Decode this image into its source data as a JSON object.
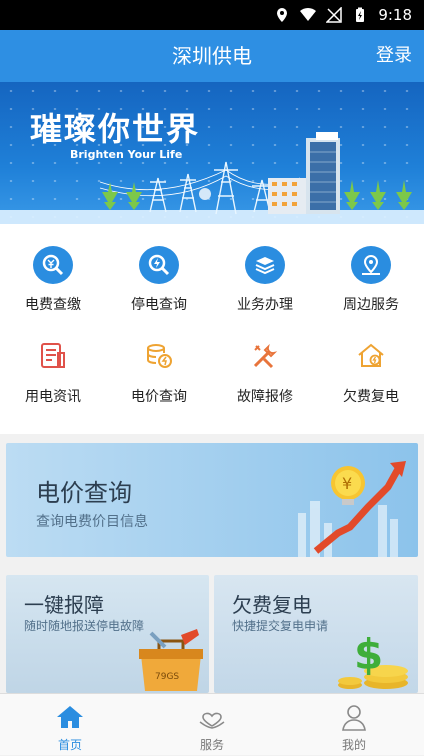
{
  "status": {
    "time": "9:18"
  },
  "header": {
    "title": "深圳供电",
    "login_label": "登录"
  },
  "banner": {
    "slogan": "璀璨你世界",
    "subtitle": "Brighten Your Life"
  },
  "services": [
    {
      "label": "电费查缴",
      "icon": "search-money-icon"
    },
    {
      "label": "停电查询",
      "icon": "lightning-search-icon"
    },
    {
      "label": "业务办理",
      "icon": "layers-icon"
    },
    {
      "label": "周边服务",
      "icon": "map-pin-icon"
    },
    {
      "label": "用电资讯",
      "icon": "document-icon"
    },
    {
      "label": "电价查询",
      "icon": "coins-icon"
    },
    {
      "label": "故障报修",
      "icon": "tools-icon"
    },
    {
      "label": "欠费复电",
      "icon": "house-power-icon"
    }
  ],
  "cards": {
    "price": {
      "title": "电价查询",
      "subtitle": "查询电费价目信息"
    },
    "report": {
      "title": "一键报障",
      "subtitle": "随时随地报送停电故障",
      "toolbox_text": "79GS"
    },
    "restore": {
      "title": "欠费复电",
      "subtitle": "快捷提交复电申请"
    }
  },
  "tabs": [
    {
      "label": "首页",
      "icon": "home-icon",
      "active": true
    },
    {
      "label": "服务",
      "icon": "heart-hands-icon",
      "active": false
    },
    {
      "label": "我的",
      "icon": "user-icon",
      "active": false
    }
  ],
  "colors": {
    "primary": "#2e8fe3",
    "accent_orange": "#e8743b",
    "text": "#222222"
  }
}
